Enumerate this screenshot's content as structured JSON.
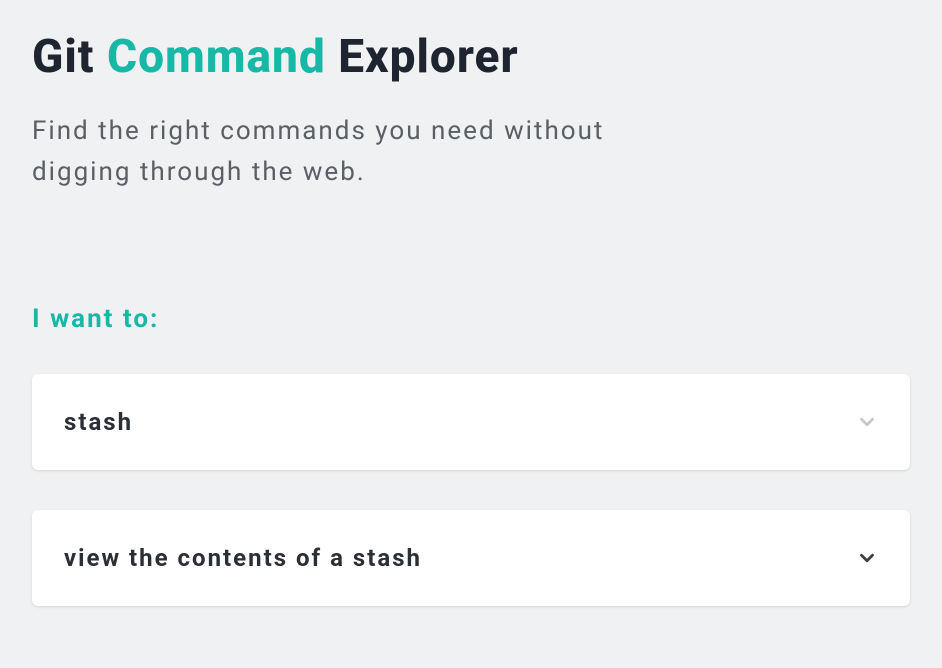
{
  "header": {
    "title_part1": "Git ",
    "title_highlight": "Command",
    "title_part2": " Explorer",
    "subtitle": "Find the right commands you need without digging through the web."
  },
  "prompt": {
    "label": "I want to:"
  },
  "dropdowns": [
    {
      "value": "stash"
    },
    {
      "value": "view the contents of a stash"
    }
  ],
  "colors": {
    "accent": "#17b8a6",
    "text_dark": "#1e2430",
    "text_muted": "#5a5f66",
    "bg": "#f0f1f2"
  }
}
